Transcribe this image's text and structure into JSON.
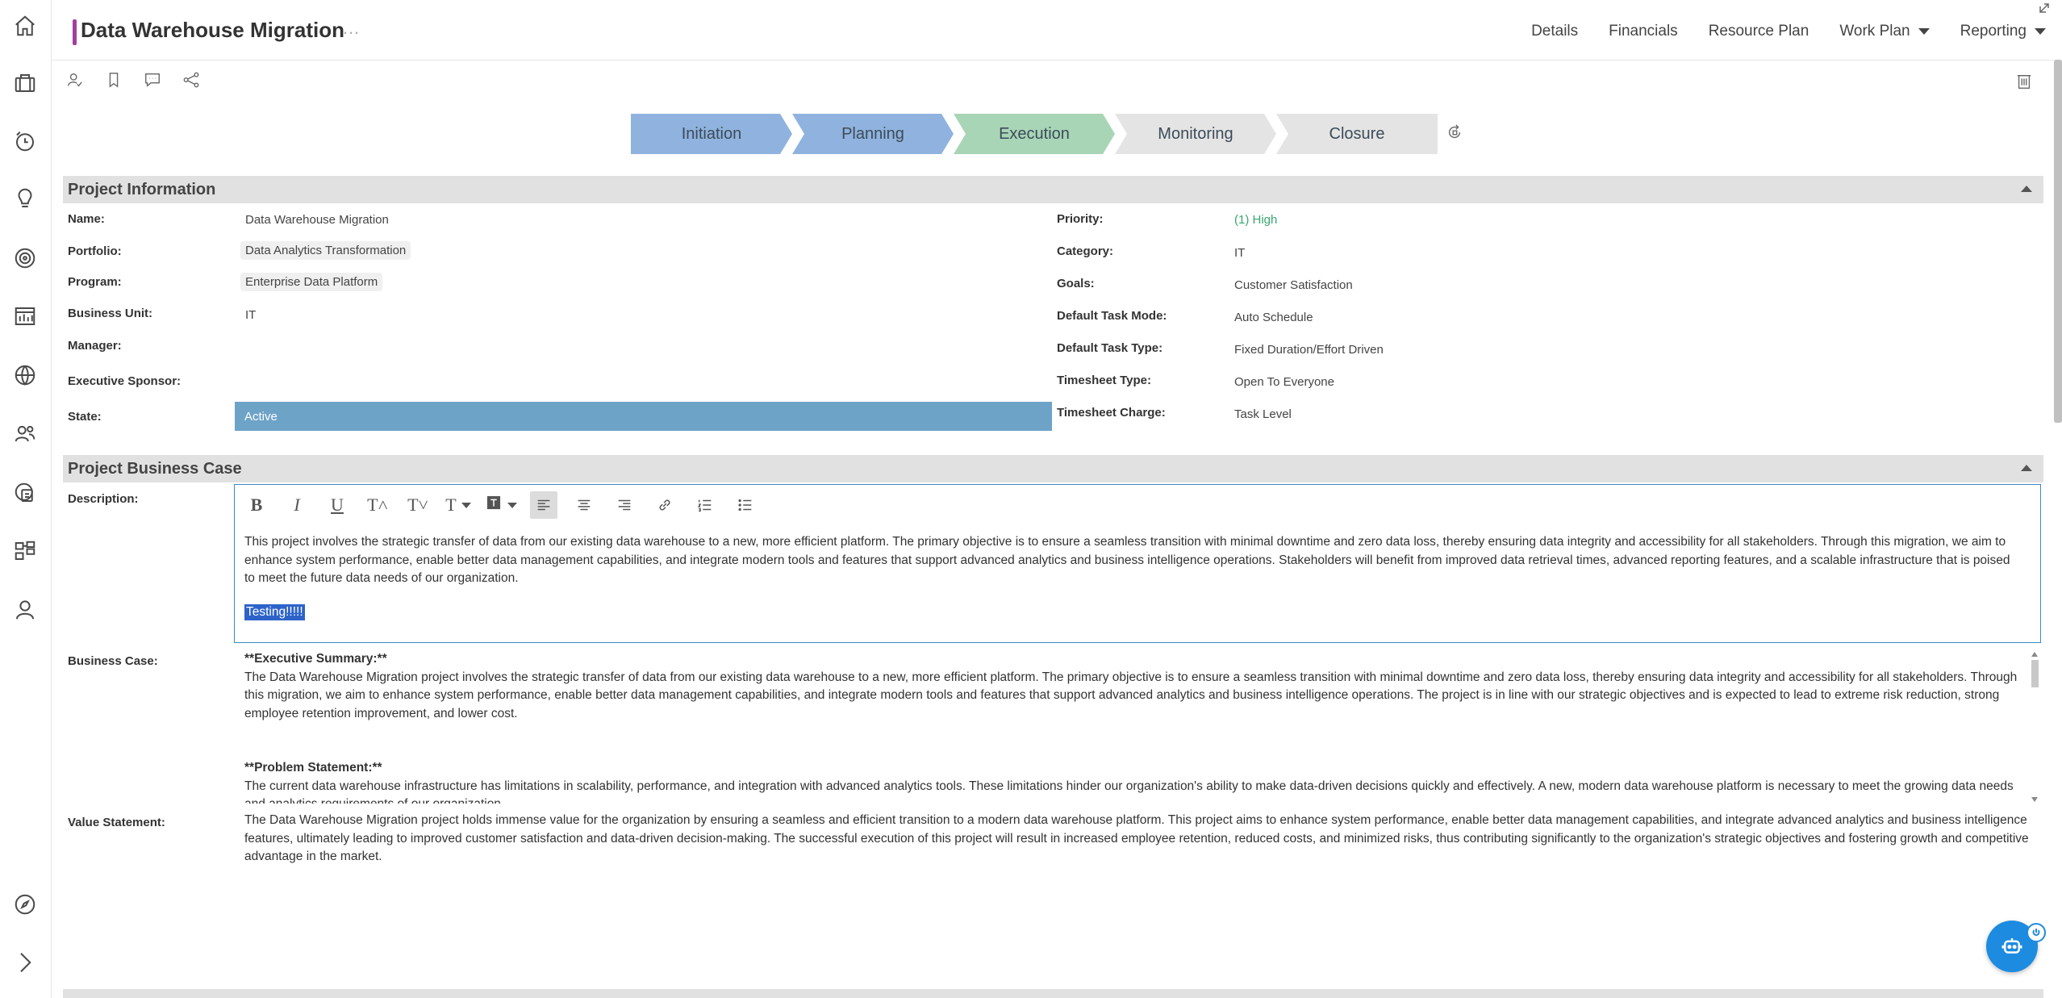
{
  "header": {
    "title": "Data Warehouse Migration",
    "more": "…",
    "nav": [
      {
        "label": "Details",
        "dropdown": false
      },
      {
        "label": "Financials",
        "dropdown": false
      },
      {
        "label": "Resource Plan",
        "dropdown": false
      },
      {
        "label": "Work Plan",
        "dropdown": true
      },
      {
        "label": "Reporting",
        "dropdown": true
      }
    ]
  },
  "sidebar": {
    "icons": [
      "home-icon",
      "briefcase-icon",
      "clock-icon",
      "lightbulb-icon",
      "target-icon",
      "dashboard-icon",
      "globe-icon",
      "team-icon",
      "report-icon",
      "org-icon",
      "user-icon",
      "compass-icon",
      "chevron-right-icon"
    ]
  },
  "toolbar": {
    "icons": [
      "assign-user-icon",
      "bookmark-icon",
      "comment-icon",
      "share-icon"
    ],
    "delete_icon": "trash-icon"
  },
  "phases": {
    "steps": [
      {
        "label": "Initiation",
        "status": "done",
        "color": "#8fb3de"
      },
      {
        "label": "Planning",
        "status": "done",
        "color": "#8fb3de"
      },
      {
        "label": "Execution",
        "status": "current",
        "color": "#a8d5b5"
      },
      {
        "label": "Monitoring",
        "status": "pending",
        "color": "#e4e4e4"
      },
      {
        "label": "Closure",
        "status": "pending",
        "color": "#e4e4e4"
      }
    ]
  },
  "project_info": {
    "section_title": "Project Information",
    "left": [
      {
        "label": "Name:",
        "value": "Data Warehouse Migration"
      },
      {
        "label": "Portfolio:",
        "value": "Data Analytics Transformation"
      },
      {
        "label": "Program:",
        "value": "Enterprise Data Platform"
      },
      {
        "label": "Business Unit:",
        "value": "IT"
      },
      {
        "label": "Manager:",
        "value": ""
      },
      {
        "label": "Executive Sponsor:",
        "value": ""
      },
      {
        "label": "State:",
        "value": "Active"
      }
    ],
    "right": [
      {
        "label": "Priority:",
        "value": "(1) High"
      },
      {
        "label": "Category:",
        "value": "IT"
      },
      {
        "label": "Goals:",
        "value": "Customer Satisfaction"
      },
      {
        "label": "Default Task Mode:",
        "value": "Auto Schedule"
      },
      {
        "label": "Default Task Type:",
        "value": "Fixed Duration/Effort Driven"
      },
      {
        "label": "Timesheet Type:",
        "value": "Open To Everyone"
      },
      {
        "label": "Timesheet Charge:",
        "value": "Task Level"
      }
    ]
  },
  "business_case": {
    "section_title": "Project Business Case",
    "description_label": "Description:",
    "editor_tools": [
      "B",
      "I",
      "U",
      "T˄",
      "T˅",
      "T",
      "T"
    ],
    "description_text": "This project involves the strategic transfer of data from our existing data warehouse to a new, more efficient platform. The primary objective is to ensure a seamless transition with minimal downtime and zero data loss, thereby ensuring data integrity and accessibility for all stakeholders. Through this migration, we aim to enhance system performance, enable better data management capabilities, and integrate modern tools and features that support advanced analytics and business intelligence operations. Stakeholders will benefit from improved data retrieval times, advanced reporting features, and a scalable infrastructure that is poised to meet the future data needs of our organization.",
    "selected_text": "Testing!!!!!",
    "business_case_label": "Business Case:",
    "exec_summary_heading": "**Executive Summary:**",
    "exec_summary_text": "The Data Warehouse Migration project involves the strategic transfer of data from our existing data warehouse to a new, more efficient platform. The primary objective is to ensure a seamless transition with minimal downtime and zero data loss, thereby ensuring data integrity and accessibility for all stakeholders. Through this migration, we aim to enhance system performance, enable better data management capabilities, and integrate modern tools and features that support advanced analytics and business intelligence operations. The project is in line with our strategic objectives and is expected to lead to extreme risk reduction, strong employee retention improvement, and lower cost.",
    "problem_heading": "**Problem Statement:**",
    "problem_text": "The current data warehouse infrastructure has limitations in scalability, performance, and integration with advanced analytics tools. These limitations hinder our organization's ability to make data-driven decisions quickly and effectively. A new, modern data warehouse platform is necessary to meet the growing data needs and analytics requirements of our organization.",
    "value_label": "Value Statement:",
    "value_text": "The Data Warehouse Migration project holds immense value for the organization by ensuring a seamless and efficient transition to a modern data warehouse platform. This project aims to enhance system performance, enable better data management capabilities, and integrate advanced analytics and business intelligence features, ultimately leading to improved customer satisfaction and data-driven decision-making. The successful execution of this project will result in increased employee retention, reduced costs, and minimized risks, thus contributing significantly to the organization's strategic objectives and fostering growth and competitive advantage in the market."
  },
  "chat": {
    "icon": "chatbot-icon",
    "badge_icon": "power-icon"
  }
}
